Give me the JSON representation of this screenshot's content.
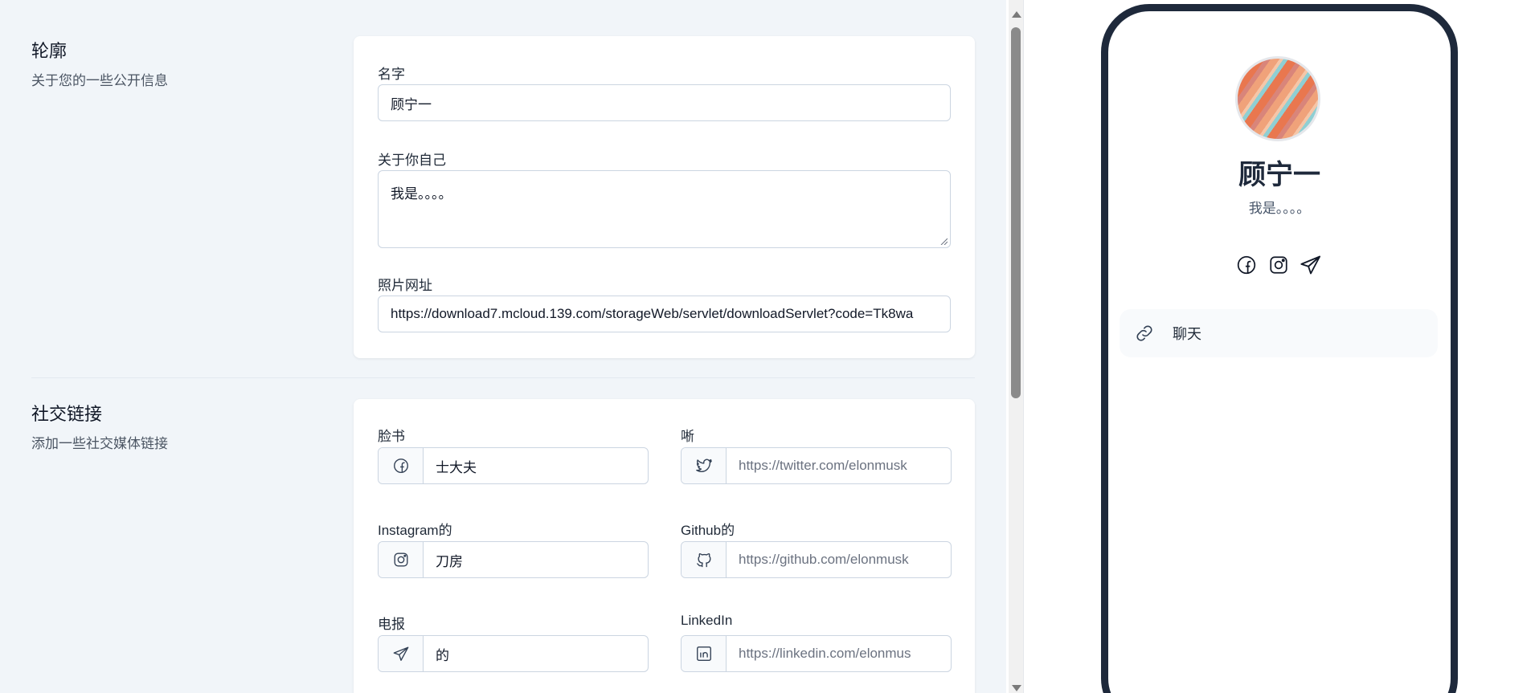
{
  "profile_section": {
    "title": "轮廓",
    "subtitle": "关于您的一些公开信息",
    "name_label": "名字",
    "name_value": "顾宁一",
    "about_label": "关于你自己",
    "about_value": "我是。。。。",
    "photo_label": "照片网址",
    "photo_value": "https://download7.mcloud.139.com/storageWeb/servlet/downloadServlet?code=Tk8wa"
  },
  "social_section": {
    "title": "社交链接",
    "subtitle": "添加一些社交媒体链接",
    "fields": [
      {
        "label": "脸书",
        "icon": "facebook-icon",
        "value": "士大夫",
        "placeholder": ""
      },
      {
        "label": "唽",
        "icon": "twitter-icon",
        "value": "",
        "placeholder": "https://twitter.com/elonmusk"
      },
      {
        "label": "Instagram的",
        "icon": "instagram-icon",
        "value": "刀房",
        "placeholder": ""
      },
      {
        "label": "Github的",
        "icon": "github-icon",
        "value": "",
        "placeholder": "https://github.com/elonmusk"
      },
      {
        "label": "电报",
        "icon": "telegram-icon",
        "value": "的",
        "placeholder": ""
      },
      {
        "label": "LinkedIn",
        "icon": "linkedin-icon",
        "value": "",
        "placeholder": "https://linkedin.com/elonmus"
      }
    ]
  },
  "preview": {
    "name": "顾宁一",
    "bio": "我是。。。。",
    "social_icons": [
      "facebook-icon",
      "instagram-icon",
      "telegram-icon"
    ],
    "links": [
      {
        "label": "聊天",
        "icon": "link-icon"
      }
    ]
  },
  "colors": {
    "page_bg": "#f1f5f9",
    "card_bg": "#ffffff",
    "border": "#cbd5e1",
    "phone_frame": "#1e293b",
    "text": "#1f2937",
    "muted": "#6b7280"
  }
}
